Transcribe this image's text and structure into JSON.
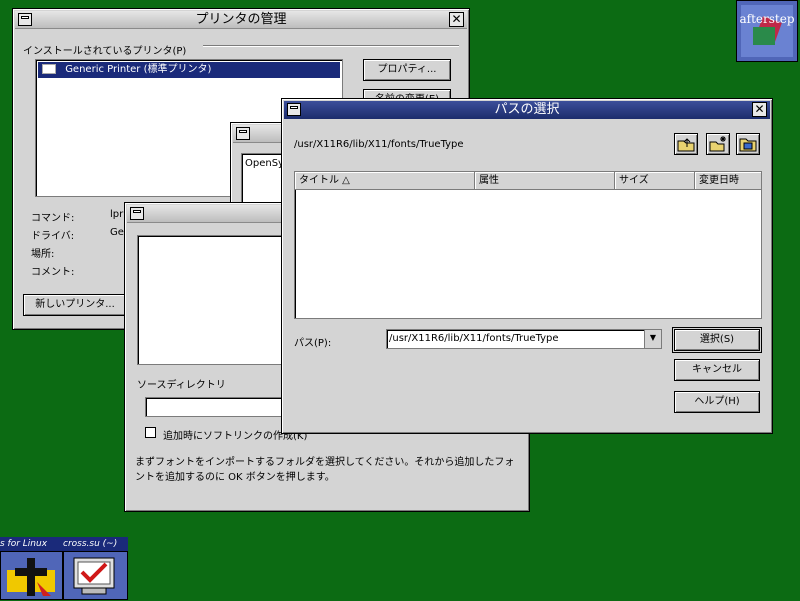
{
  "printer_manager": {
    "title": "プリンタの管理",
    "installed_label": "インストールされているプリンタ(P)",
    "printers": [
      {
        "name": "Generic Printer (標準プリンタ)",
        "selected": true
      }
    ],
    "properties_button": "プロパティ...",
    "rename_button": "名前の変更(E)",
    "command_label": "コマンド:",
    "command_value": "lpr",
    "driver_label": "ドライバ:",
    "driver_value": "Gen",
    "location_label": "場所:",
    "comment_label": "コメント:",
    "new_printer_button": "新しいプリンタ..."
  },
  "small_window": {
    "list_item": "OpenSy"
  },
  "font_import": {
    "source_dir_label": "ソースディレクトリ",
    "softlink_label": "追加時にソフトリンクの作成(K)",
    "instruction": "まずフォントをインポートするフォルダを選択してください。それから追加したフォントを追加するのに OK ボタンを押します。"
  },
  "path_dialog": {
    "title": "パスの選択",
    "current_path": "/usr/X11R6/lib/X11/fonts/TrueType",
    "columns": [
      "タイトル △",
      "属性",
      "サイズ",
      "変更日時"
    ],
    "path_label": "パス(P):",
    "path_value": "/usr/X11R6/lib/X11/fonts/TrueType",
    "select_button": "選択(S)",
    "cancel_button": "キャンセル",
    "help_button": "ヘルプ(H)"
  },
  "taskbar": {
    "items": [
      "s for Linux",
      "cross.su (~)"
    ]
  },
  "desktop": {
    "logo_text": "afterstep"
  }
}
